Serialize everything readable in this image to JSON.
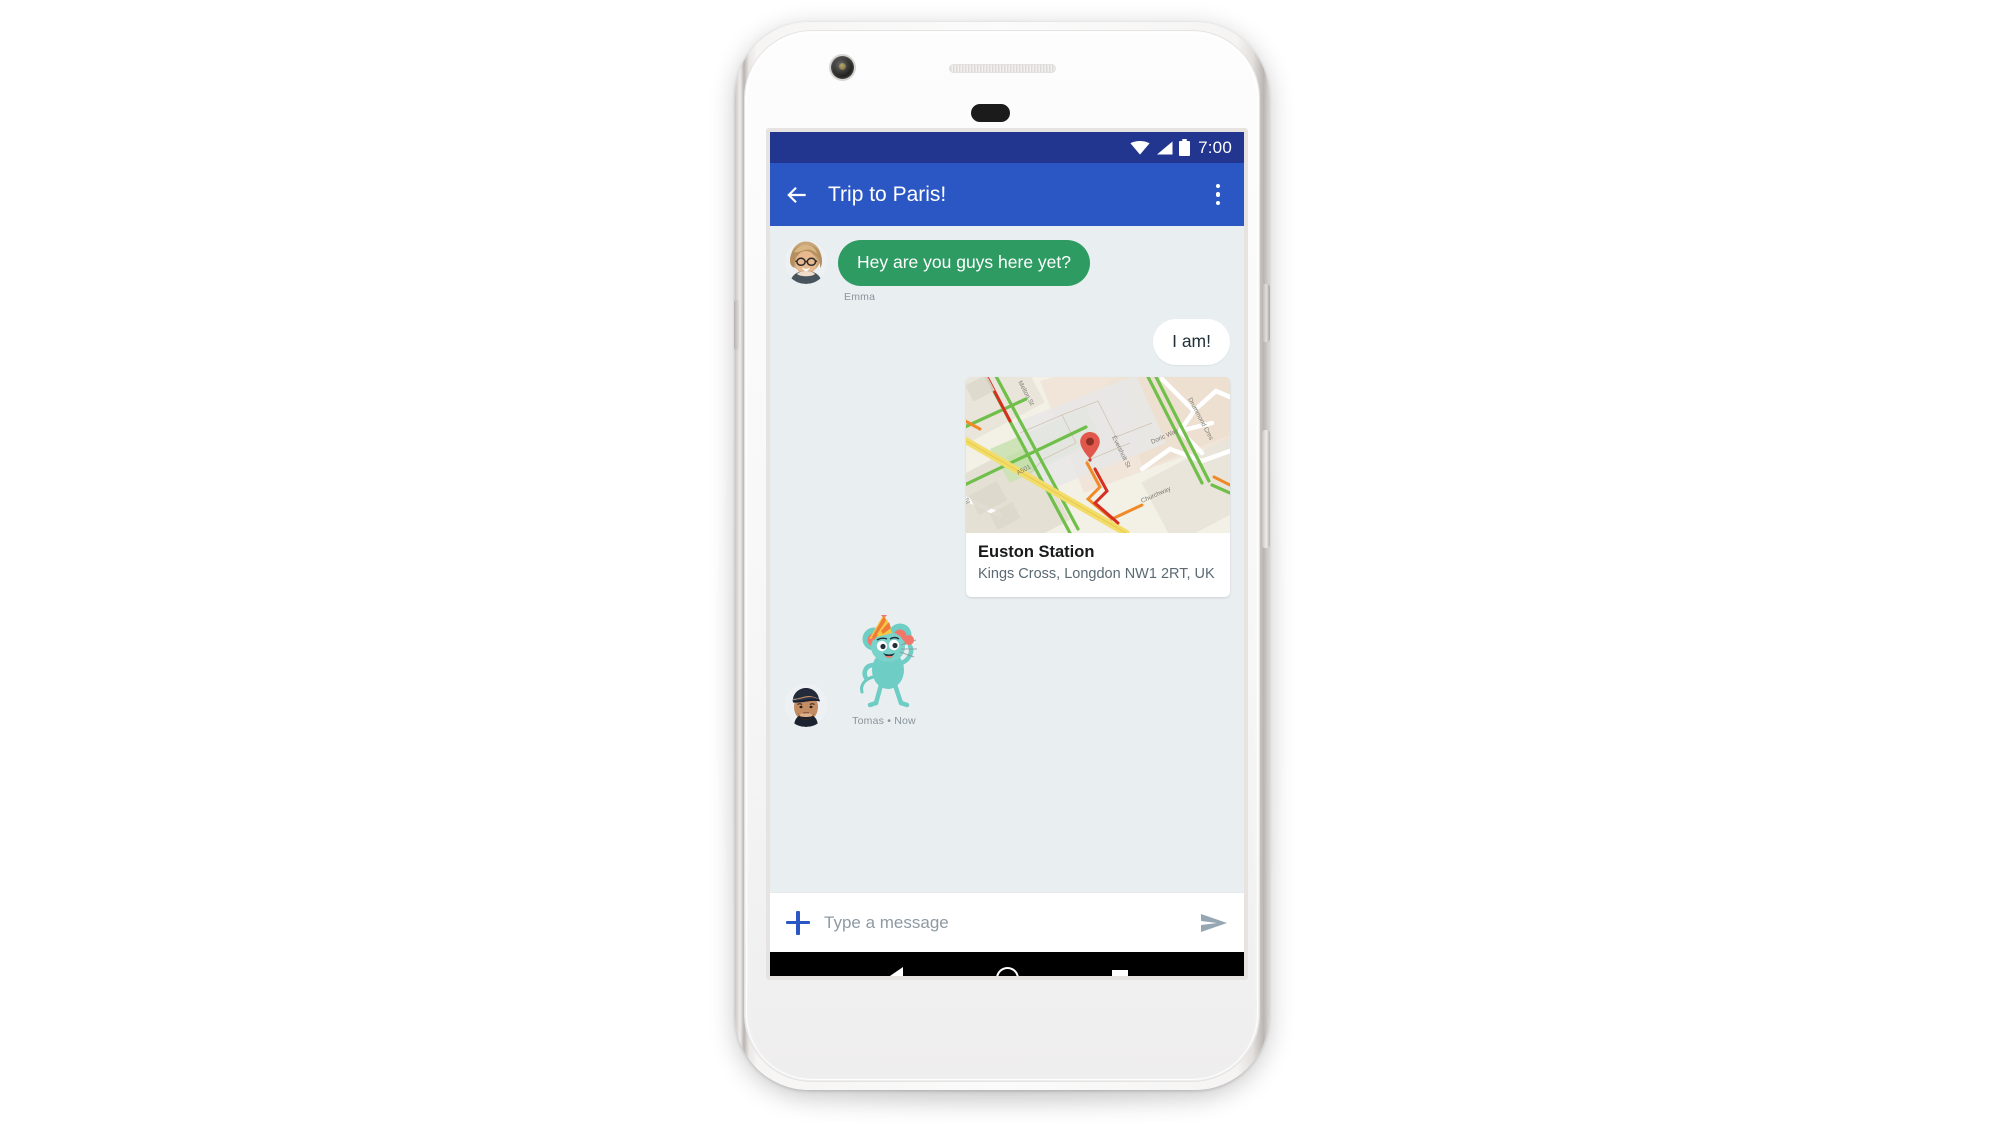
{
  "device": {
    "name": "white-android-phone",
    "hardware": {
      "camera": "front-camera",
      "earpiece": "earpiece-speaker",
      "sensor": "proximity-sensor",
      "power_button": "power-button",
      "volume_button": "volume-rocker"
    }
  },
  "status_bar": {
    "time": "7:00",
    "icons": [
      "wifi-icon",
      "cell-signal-icon",
      "battery-icon"
    ],
    "background_color": "#22368f"
  },
  "app_bar": {
    "title": "Trip to Paris!",
    "back_icon": "arrow-back-icon",
    "overflow_icon": "more-vert-icon",
    "background_color": "#2b57c4"
  },
  "conversation": {
    "background_color": "#e9eef1",
    "messages": [
      {
        "id": "msg-emma-greeting",
        "direction": "incoming",
        "type": "text",
        "text": "Hey are you guys here yet?",
        "sender": "Emma",
        "avatar": "emma-avatar",
        "bubble_color": "#2e9b63",
        "text_color": "#ffffff"
      },
      {
        "id": "msg-self-reply",
        "direction": "outgoing",
        "type": "text",
        "text": "I am!",
        "bubble_color": "#ffffff",
        "text_color": "#22303a"
      },
      {
        "id": "msg-self-location",
        "direction": "outgoing",
        "type": "location-card",
        "place_name": "Euston Station",
        "place_address": "Kings Cross, Longdon NW1 2RT, UK",
        "map_pin": "map-pin-icon",
        "map_labels": [
          "Melton St",
          "A501",
          "Eversholt St",
          "Doric Way",
          "Drummond Cres",
          "Churchway"
        ]
      },
      {
        "id": "msg-tomas-sticker",
        "direction": "incoming",
        "type": "sticker",
        "sticker_name": "party-mouse-sticker",
        "sender": "Tomas",
        "timestamp": "Now",
        "meta": "Tomas • Now",
        "avatar": "tomas-avatar"
      }
    ]
  },
  "composer": {
    "add_icon": "plus-icon",
    "placeholder": "Type a message",
    "value": "",
    "send_icon": "send-icon",
    "accent_color": "#2b57c4"
  },
  "nav_bar": {
    "back": "nav-back-icon",
    "home": "nav-home-icon",
    "recents": "nav-recents-icon",
    "background_color": "#000000"
  }
}
